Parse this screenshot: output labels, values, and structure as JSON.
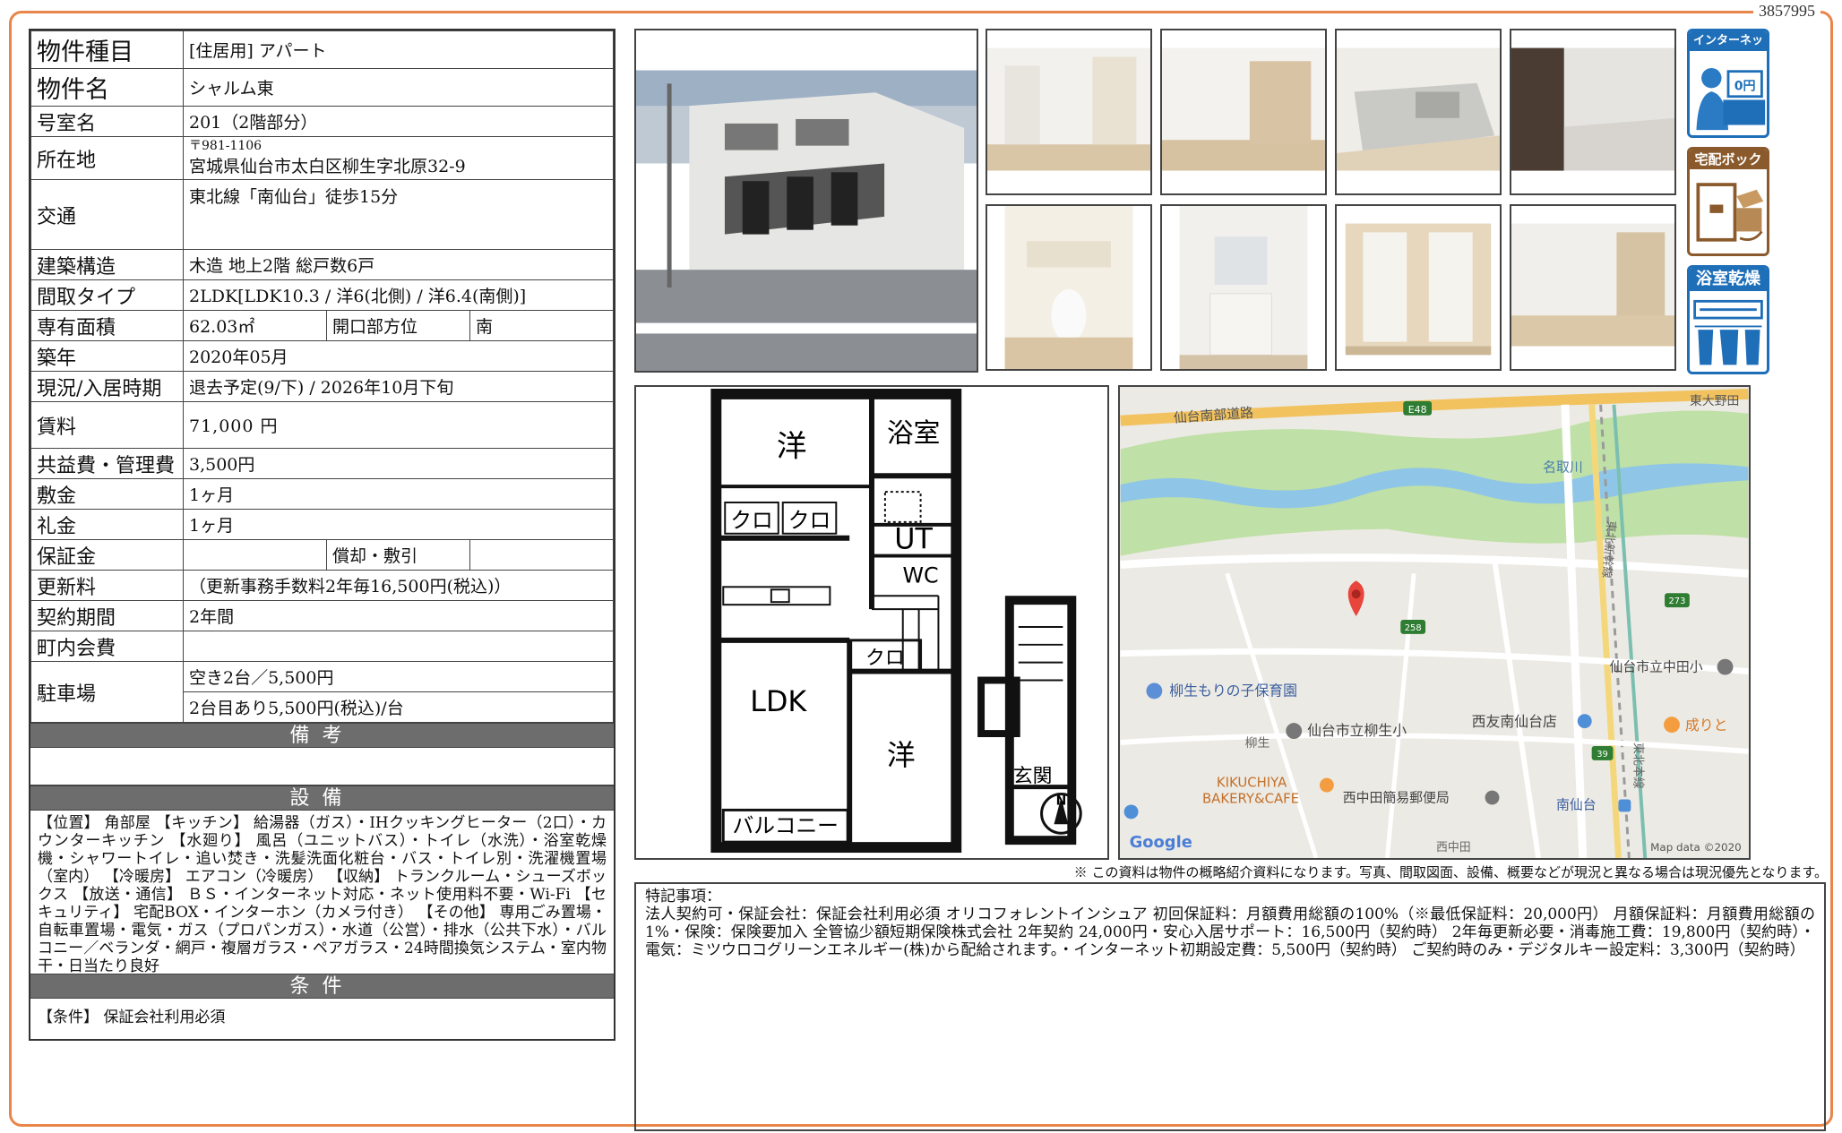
{
  "doc_id": "3857995",
  "info": {
    "type_label": "物件種目",
    "type_value": "[住居用] アパート",
    "name_label": "物件名",
    "name_value": "シャルム東",
    "room_label": "号室名",
    "room_value": "201（2階部分）",
    "address_label": "所在地",
    "postal": "〒981-1106",
    "address": "宮城県仙台市太白区柳生字北原32-9",
    "transport_label": "交通",
    "transport_value": "東北線「南仙台」徒歩15分",
    "structure_label": "建築構造",
    "structure_value": "木造 地上2階 総戸数6戸",
    "layout_label": "間取タイプ",
    "layout_value": "2LDK[LDK10.3 / 洋6(北側) / 洋6.4(南側)]",
    "area_label": "専有面積",
    "area_value": "62.03㎡",
    "direction_label": "開口部方位",
    "direction_value": "南",
    "built_label": "築年",
    "built_value": "2020年05月",
    "status_label": "現況/入居時期",
    "status_value": "退去予定(9/下) / 2026年10月下旬",
    "rent_label": "賃料",
    "rent_value": "71,000 円",
    "fee_label": "共益費・管理費",
    "fee_value": "3,500円",
    "deposit_label": "敷金",
    "deposit_value": "1ヶ月",
    "key_money_label": "礼金",
    "key_money_value": "1ヶ月",
    "guarantee_label": "保証金",
    "guarantee_value": "",
    "amort_label": "償却・敷引",
    "amort_value": "",
    "renewal_label": "更新料",
    "renewal_value": "（更新事務手数料2年毎16,500円(税込)）",
    "contract_label": "契約期間",
    "contract_value": "2年間",
    "town_fee_label": "町内会費",
    "town_fee_value": "",
    "parking_label": "駐車場",
    "parking_value1": "空き2台／5,500円",
    "parking_value2": "2台目あり5,500円(税込)/台"
  },
  "sections": {
    "notes_title": "備考",
    "equipment_title": "設備",
    "equipment_text": "【位置】 角部屋 【キッチン】 給湯器（ガス）・IHクッキングヒーター（2口）・カウンターキッチン 【水廻り】 風呂（ユニットバス）・トイレ（水洗）・浴室乾燥機・シャワートイレ・追い焚き・洗髪洗面化粧台・バス・トイレ別・洗濯機置場（室内） 【冷暖房】 エアコン（冷暖房） 【収納】 トランクルーム・シューズボックス 【放送・通信】 ＢＳ・インターネット対応・ネット使用料不要・Wi-Fi 【セキュリティ】 宅配BOX・インターホン（カメラ付き） 【その他】 専用ごみ置場・自転車置場・電気・ガス（プロパンガス）・水道（公営）・排水（公共下水）・バルコニー／ベランダ・網戸・複層ガラス・ペアガラス・24時間換気システム・室内物干・日当たり良好",
    "conditions_title": "条件",
    "conditions_text": "【条件】 保証会社利用必須"
  },
  "badges": {
    "internet": "インターネット無料",
    "internet_price": "0円",
    "delivery": "宅配ボックス",
    "bath_dryer": "浴室乾燥機"
  },
  "floorplan": {
    "room_west_north": "洋",
    "bath": "浴室",
    "closet1": "クロ",
    "closet2": "クロ",
    "ut": "UT",
    "wc": "WC",
    "closet3": "クロ",
    "ldk": "LDK",
    "room_south": "洋",
    "balcony": "バルコニー",
    "entrance": "玄関",
    "north": "N"
  },
  "map": {
    "road1": "仙台南部道路",
    "e48": "E48",
    "river": "名取川",
    "area_top": "東大野田",
    "route258": "258",
    "route273": "273",
    "route39": "39",
    "nursery": "柳生もりの子保育園",
    "school1": "仙台市立中田小",
    "school2": "仙台市立柳生小",
    "store1": "西友南仙台店",
    "store2": "成りと",
    "bakery1": "KIKUCHIYA",
    "bakery2": "BAKERY&CAFE",
    "post": "西中田簡易郵便局",
    "station": "南仙台",
    "yagyu": "柳生",
    "line1": "東北本線",
    "line2": "東北新幹線",
    "nishinakada": "西中田",
    "google": "Google",
    "mapdata": "Map data ©2020"
  },
  "disclaimer": "※ この資料は物件の概略紹介資料になります。写真、間取図面、設備、概要などが現況と異なる場合は現況優先となります。",
  "special": {
    "title": "特記事項：",
    "text": "法人契約可・保証会社：保証会社利用必須 オリコフォレントインシュア 初回保証料：月額費用総額の100%（※最低保証料：20,000円） 月額保証料：月額費用総額の1%・保険：保険要加入 全管協少額短期保険株式会社 2年契約 24,000円・安心入居サポート：16,500円（契約時） 2年毎更新必要・消毒施工費：19,800円（契約時）・電気：ミツウロコグリーンエネルギー(株)から配給されます。・インターネット初期設定費：5,500円（契約時） ご契約時のみ・デジタルキー設定料：3,300円（契約時）"
  },
  "colors": {
    "frame": "#e8854a",
    "section_bar": "#6d6d6d",
    "badge_blue": "#1f6fb8",
    "badge_brown": "#8a5a2c"
  }
}
